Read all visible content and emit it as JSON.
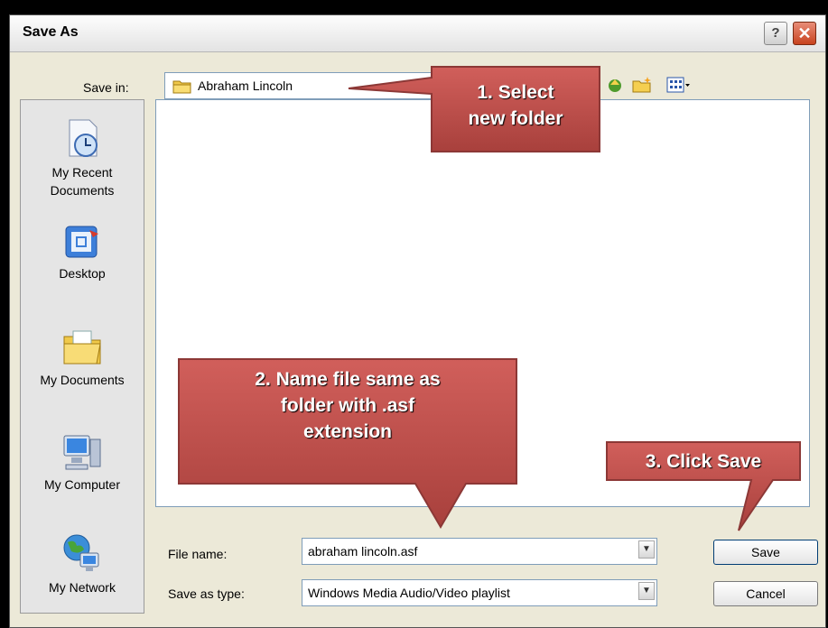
{
  "dialog": {
    "title": "Save As"
  },
  "save_in": {
    "label": "Save in:",
    "value": "Abraham Lincoln"
  },
  "places": [
    {
      "label_lines": [
        "My Recent",
        "Documents"
      ],
      "icon": "recent-documents-icon"
    },
    {
      "label_lines": [
        "Desktop"
      ],
      "icon": "desktop-icon"
    },
    {
      "label_lines": [
        "My Documents"
      ],
      "icon": "my-documents-icon"
    },
    {
      "label_lines": [
        "My Computer"
      ],
      "icon": "my-computer-icon"
    },
    {
      "label_lines": [
        "My Network"
      ],
      "icon": "my-network-icon"
    }
  ],
  "file_name": {
    "label": "File name:",
    "value": "abraham lincoln.asf"
  },
  "save_as_type": {
    "label": "Save as type:",
    "value": "Windows Media Audio/Video playlist"
  },
  "buttons": {
    "save": "Save",
    "cancel": "Cancel",
    "help": "?",
    "close": "✕"
  },
  "callouts": {
    "step1": [
      "1. Select",
      "new folder"
    ],
    "step2": [
      "2. Name file same as",
      "folder with .asf",
      "extension"
    ],
    "step3": [
      "3. Click Save"
    ]
  },
  "colors": {
    "callout_fill": "#c0504d",
    "callout_border": "#8c3836",
    "window_bg": "#ece9d8"
  }
}
